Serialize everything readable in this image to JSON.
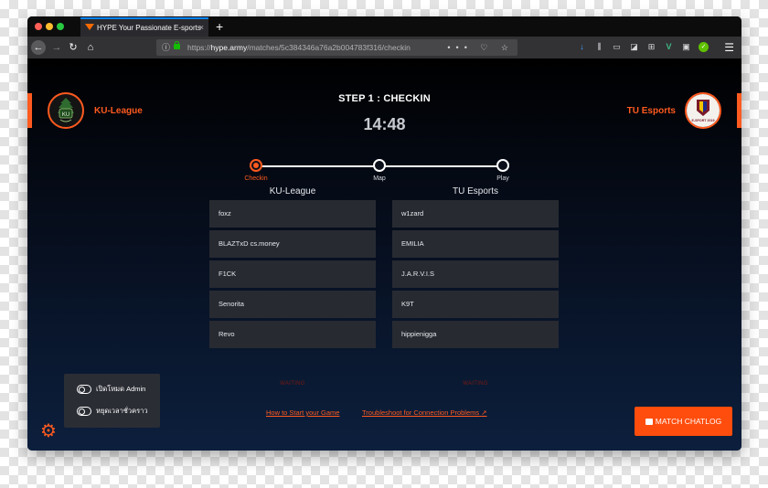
{
  "browser": {
    "tab_title": "HYPE Your Passionate E-sports",
    "tab_close": "×",
    "new_tab": "+",
    "url_prefix": "https://",
    "url_host": "hype.army",
    "url_path": "/matches/5c384346a76a2b004783f316/checkin",
    "url_actions": "••• ♡ ☆",
    "menu": "☰"
  },
  "match": {
    "step_title": "STEP 1 : CHECKIN",
    "countdown": "14:48",
    "team_left": "KU-League",
    "team_right": "TU Esports",
    "team_left_logo_text": "KU",
    "team_right_logo_text": "E-SPORT 2019"
  },
  "stepper": {
    "steps": [
      {
        "label": "Checkin",
        "active": true
      },
      {
        "label": "Map",
        "active": false
      },
      {
        "label": "Play",
        "active": false
      }
    ]
  },
  "rosters": {
    "left": {
      "title": "KU-League",
      "players": [
        "foxz",
        "BLAZTxD cs.money",
        "F1CK",
        "Senorita",
        "Revo"
      ],
      "status": "WAITING"
    },
    "right": {
      "title": "TU Esports",
      "players": [
        "w1zard",
        "EMILIA",
        "J.A.R.V.I.S",
        "K9T",
        "hippienigga"
      ],
      "status": "WAITING"
    }
  },
  "links": {
    "how_to_start": "How to Start your Game",
    "troubleshoot": "Troubleshoot for Connection Problems"
  },
  "admin": {
    "toggle_admin": "เปิดโหมด Admin",
    "toggle_pause": "หยุดเวลาชั่วคราว"
  },
  "chat": {
    "button_label": "MATCH CHATLOG"
  },
  "colors": {
    "accent": "#ff5a1f",
    "row_bg": "#272a31",
    "waiting": "#7a1a12"
  }
}
